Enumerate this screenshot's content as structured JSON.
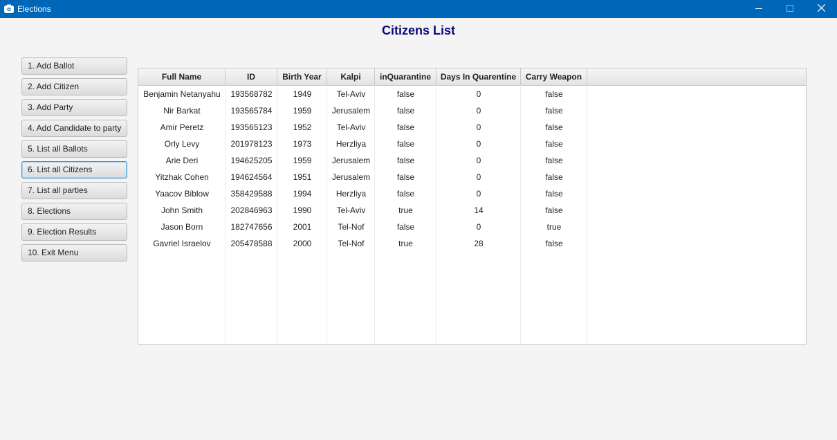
{
  "window": {
    "title": "Elections",
    "controls": [
      "minimize-icon",
      "maximize-icon",
      "close-icon"
    ]
  },
  "page": {
    "title": "Citizens List"
  },
  "menu": {
    "items": [
      {
        "label": "1. Add Ballot",
        "selected": false
      },
      {
        "label": "2. Add Citizen",
        "selected": false
      },
      {
        "label": "3. Add Party",
        "selected": false
      },
      {
        "label": "4. Add Candidate to party",
        "selected": false
      },
      {
        "label": "5. List all Ballots",
        "selected": false
      },
      {
        "label": "6. List all Citizens",
        "selected": true
      },
      {
        "label": "7. List all parties",
        "selected": false
      },
      {
        "label": "8. Elections",
        "selected": false
      },
      {
        "label": "9. Election Results",
        "selected": false
      },
      {
        "label": "10. Exit Menu",
        "selected": false
      }
    ]
  },
  "table": {
    "columns": [
      "Full Name",
      "ID",
      "Birth Year",
      "Kalpi",
      "inQuarantine",
      "Days In Quarentine",
      "Carry Weapon"
    ],
    "rows": [
      [
        "Benjamin Netanyahu",
        "193568782",
        "1949",
        "Tel-Aviv",
        "false",
        "0",
        "false"
      ],
      [
        "Nir Barkat",
        "193565784",
        "1959",
        "Jerusalem",
        "false",
        "0",
        "false"
      ],
      [
        "Amir Peretz",
        "193565123",
        "1952",
        "Tel-Aviv",
        "false",
        "0",
        "false"
      ],
      [
        "Orly Levy",
        "201978123",
        "1973",
        "Herzliya",
        "false",
        "0",
        "false"
      ],
      [
        "Arie Deri",
        "194625205",
        "1959",
        "Jerusalem",
        "false",
        "0",
        "false"
      ],
      [
        "Yitzhak Cohen",
        "194624564",
        "1951",
        "Jerusalem",
        "false",
        "0",
        "false"
      ],
      [
        "Yaacov Biblow",
        "358429588",
        "1994",
        "Herzliya",
        "false",
        "0",
        "false"
      ],
      [
        "John Smith",
        "202846963",
        "1990",
        "Tel-Aviv",
        "true",
        "14",
        "false"
      ],
      [
        "Jason Born",
        "182747656",
        "2001",
        "Tel-Nof",
        "false",
        "0",
        "true"
      ],
      [
        "Gavriel Israelov",
        "205478588",
        "2000",
        "Tel-Nof",
        "true",
        "28",
        "false"
      ]
    ]
  },
  "colors": {
    "titlebar": "#0067b8",
    "page_title": "#0b0b7a",
    "selected_border": "#2f95d6"
  }
}
